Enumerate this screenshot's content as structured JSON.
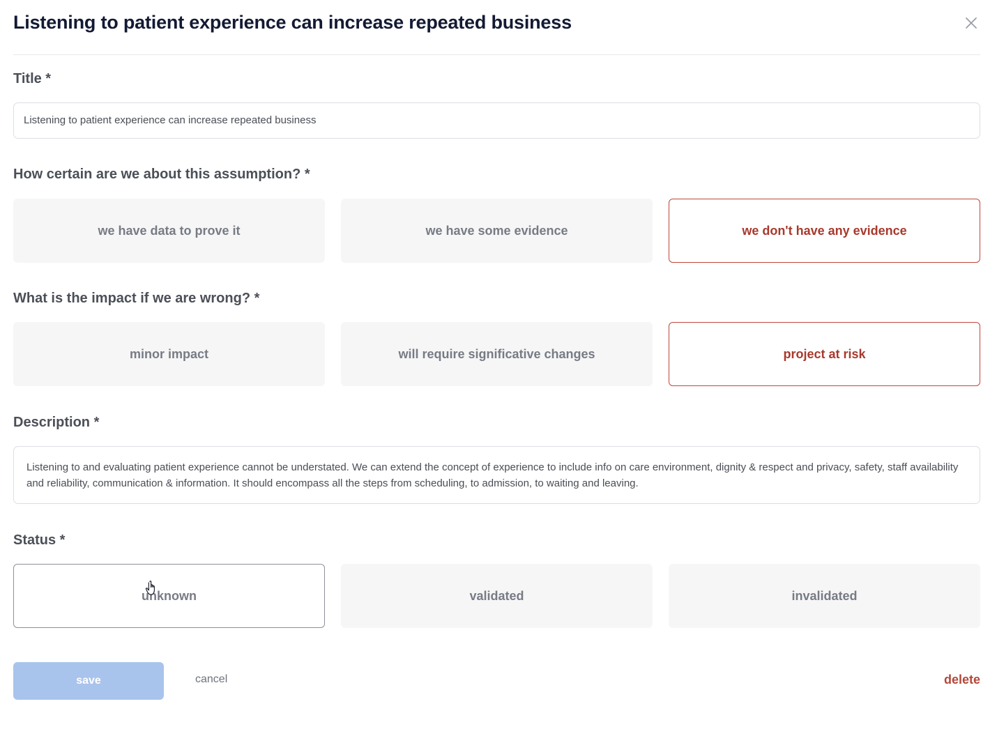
{
  "modal": {
    "title": "Listening to patient experience can increase repeated business",
    "close_icon": "close-icon"
  },
  "title_field": {
    "label": "Title *",
    "value": "Listening to patient experience can increase repeated business"
  },
  "certainty": {
    "label": "How certain are we about this assumption? *",
    "options": [
      "we have data to prove it",
      "we have some evidence",
      "we don't have any evidence"
    ],
    "selected": "we don't have any evidence"
  },
  "impact": {
    "label": "What is the impact if we are wrong? *",
    "options": [
      "minor impact",
      "will require significative changes",
      "project at risk"
    ],
    "selected": "project at risk"
  },
  "description": {
    "label": "Description *",
    "value": "Listening to and evaluating patient experience cannot be understated. We can extend the concept of experience to include info on care environment, dignity & respect and privacy, safety, staff availability and reliability, communication & information. It should encompass all the steps from scheduling, to admission, to waiting and leaving."
  },
  "status": {
    "label": "Status *",
    "options": [
      "unknown",
      "validated",
      "invalidated"
    ],
    "selected": "unknown"
  },
  "actions": {
    "save": "save",
    "cancel": "cancel",
    "delete": "delete"
  },
  "colors": {
    "accent_red": "#c0463a",
    "save_button": "#a9c4ec",
    "option_background": "#f6f6f7"
  },
  "cursor_icon": "hand-pointer-icon"
}
